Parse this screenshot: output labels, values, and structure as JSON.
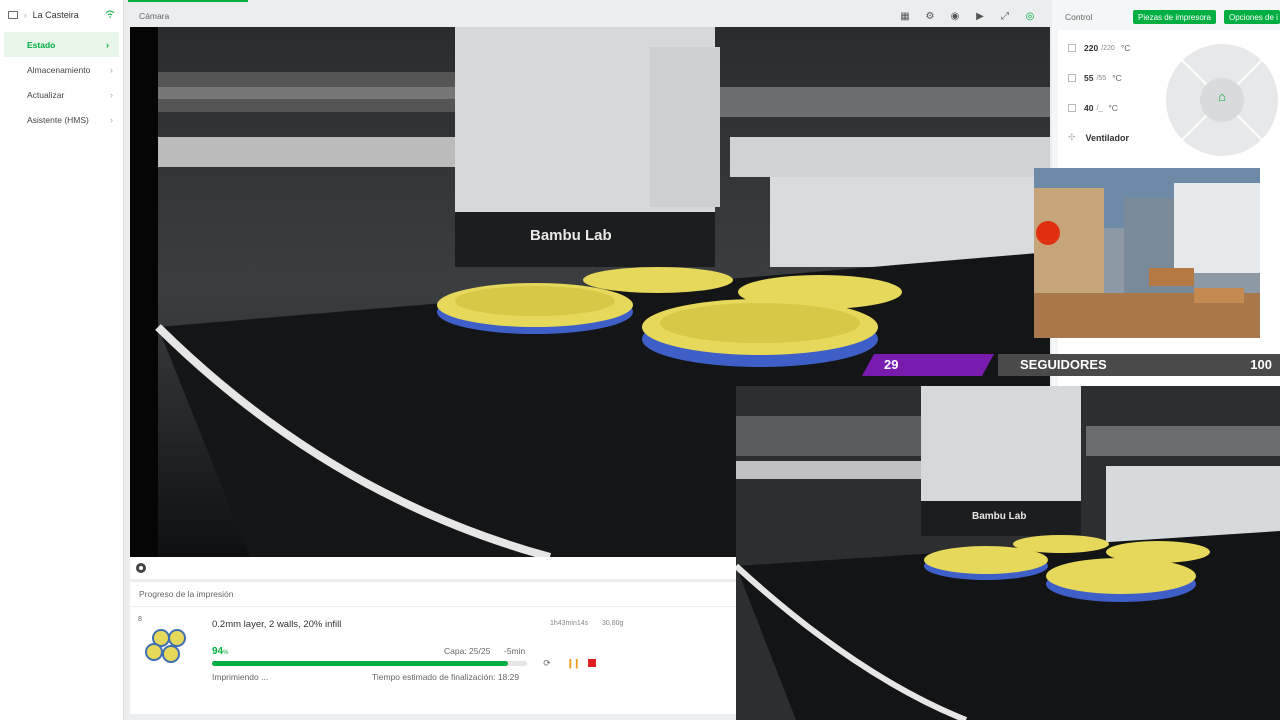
{
  "sidebar": {
    "printer_name": "La Casteira",
    "items": [
      {
        "label": "Estado"
      },
      {
        "label": "Almacenamiento"
      },
      {
        "label": "Actualizar"
      },
      {
        "label": "Asistente (HMS)"
      }
    ]
  },
  "camera": {
    "title": "Cámara",
    "brand_text": "Bambu Lab"
  },
  "progress": {
    "title": "Progreso de la impresión",
    "plate_number": "8",
    "job_name": "0.2mm layer, 2 walls, 20% infill",
    "duration": "1h43min14s",
    "weight": "30,80g",
    "percent_value": "94",
    "percent_unit": "%",
    "progress_fraction": 0.94,
    "layer": "Capa: 25/25",
    "remaining": "-5min",
    "status": "Imprimiendo ...",
    "eta": "Tiempo estimado de finalización: 18:29"
  },
  "control": {
    "title": "Control",
    "parts_button": "Piezas de impresora",
    "options_button": "Opciones de i",
    "nozzle": {
      "current": "220",
      "target": "/220",
      "unit": "°C"
    },
    "bed": {
      "current": "55",
      "target": "/55",
      "unit": "°C"
    },
    "chamber": {
      "current": "40",
      "target": "/_",
      "unit": "°C"
    },
    "fan_label": "Ventilador"
  },
  "overlay": {
    "followers_count": "29",
    "followers_label": "SEGUIDORES",
    "followers_goal": "100"
  },
  "colors": {
    "accent": "#00ae42",
    "purple": "#7a1bb0",
    "stop": "#e02020",
    "pause": "#f0a020"
  }
}
